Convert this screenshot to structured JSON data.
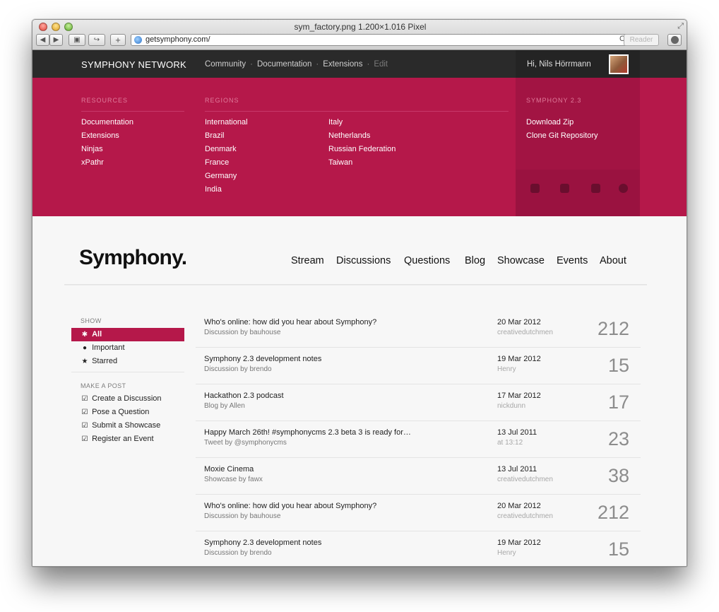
{
  "window": {
    "title": "sym_factory.png 1.200×1.016 Pixel",
    "url": "getsymphony.com/",
    "reader_label": "Reader"
  },
  "toolbar": {
    "back_icon": "◀",
    "forward_icon": "▶",
    "reading_list_icon": "▣",
    "share_icon": "↪",
    "add_icon": "+",
    "reload_icon": "C"
  },
  "network": {
    "brand": "SYMPHONY NETWORK",
    "links": [
      "Community",
      "Documentation",
      "Extensions"
    ],
    "separator": "·",
    "edit_label": "Edit",
    "greeting": "Hi, Nils Hörrmann"
  },
  "panel": {
    "resources_heading": "RESOURCES",
    "resources": [
      "Documentation",
      "Extensions",
      "Ninjas",
      "xPathr"
    ],
    "regions_heading": "REGIONS",
    "regions_col1": [
      "International",
      "Brazil",
      "Denmark",
      "France",
      "Germany",
      "India"
    ],
    "regions_col2": [
      "Italy",
      "Netherlands",
      "Russian Federation",
      "Taiwan"
    ],
    "release_heading": "SYMPHONY 2.3",
    "release_links": [
      "Download Zip",
      "Clone Git Repository"
    ],
    "social_icons": [
      "twitter-icon",
      "vimeo-icon",
      "github-icon",
      "flickr-icon"
    ]
  },
  "main": {
    "logo": "Symphony.",
    "nav": [
      "Stream",
      "Discussions",
      "Questions",
      "Blog",
      "Showcase",
      "Events",
      "About"
    ]
  },
  "sidebar": {
    "show_heading": "SHOW",
    "filters": [
      {
        "label": "All",
        "icon": "✱"
      },
      {
        "label": "Important",
        "icon": "●"
      },
      {
        "label": "Starred",
        "icon": "★"
      }
    ],
    "make_heading": "MAKE A POST",
    "post_actions": [
      {
        "label": "Create a Discussion",
        "icon": "☑"
      },
      {
        "label": "Pose a Question",
        "icon": "☑"
      },
      {
        "label": "Submit a Showcase",
        "icon": "☑"
      },
      {
        "label": "Register an Event",
        "icon": "☑"
      }
    ]
  },
  "stream": [
    {
      "title": "Who's online: how did you hear about Symphony?",
      "sub": "Discussion by bauhouse",
      "date": "20 Mar 2012",
      "who": "creativedutchmen",
      "count": "212"
    },
    {
      "title": "Symphony 2.3 development notes",
      "sub": "Discussion by brendo",
      "date": "19 Mar 2012",
      "who": "Henry",
      "count": "15"
    },
    {
      "title": "Hackathon 2.3 podcast",
      "sub": "Blog by Allen",
      "date": "17 Mar 2012",
      "who": "nickdunn",
      "count": "17"
    },
    {
      "title": "Happy March 26th! #symphonycms 2.3 beta 3 is ready for…",
      "sub": "Tweet by @symphonycms",
      "date": "13 Jul 2011",
      "who": "at 13:12",
      "count": "23"
    },
    {
      "title": "Moxie Cinema",
      "sub": "Showcase by fawx",
      "date": "13 Jul 2011",
      "who": "creativedutchmen",
      "count": "38"
    },
    {
      "title": "Who's online: how did you hear about Symphony?",
      "sub": "Discussion by bauhouse",
      "date": "20 Mar 2012",
      "who": "creativedutchmen",
      "count": "212"
    },
    {
      "title": "Symphony 2.3 development notes",
      "sub": "Discussion by brendo",
      "date": "19 Mar 2012",
      "who": "Henry",
      "count": "15"
    }
  ]
}
